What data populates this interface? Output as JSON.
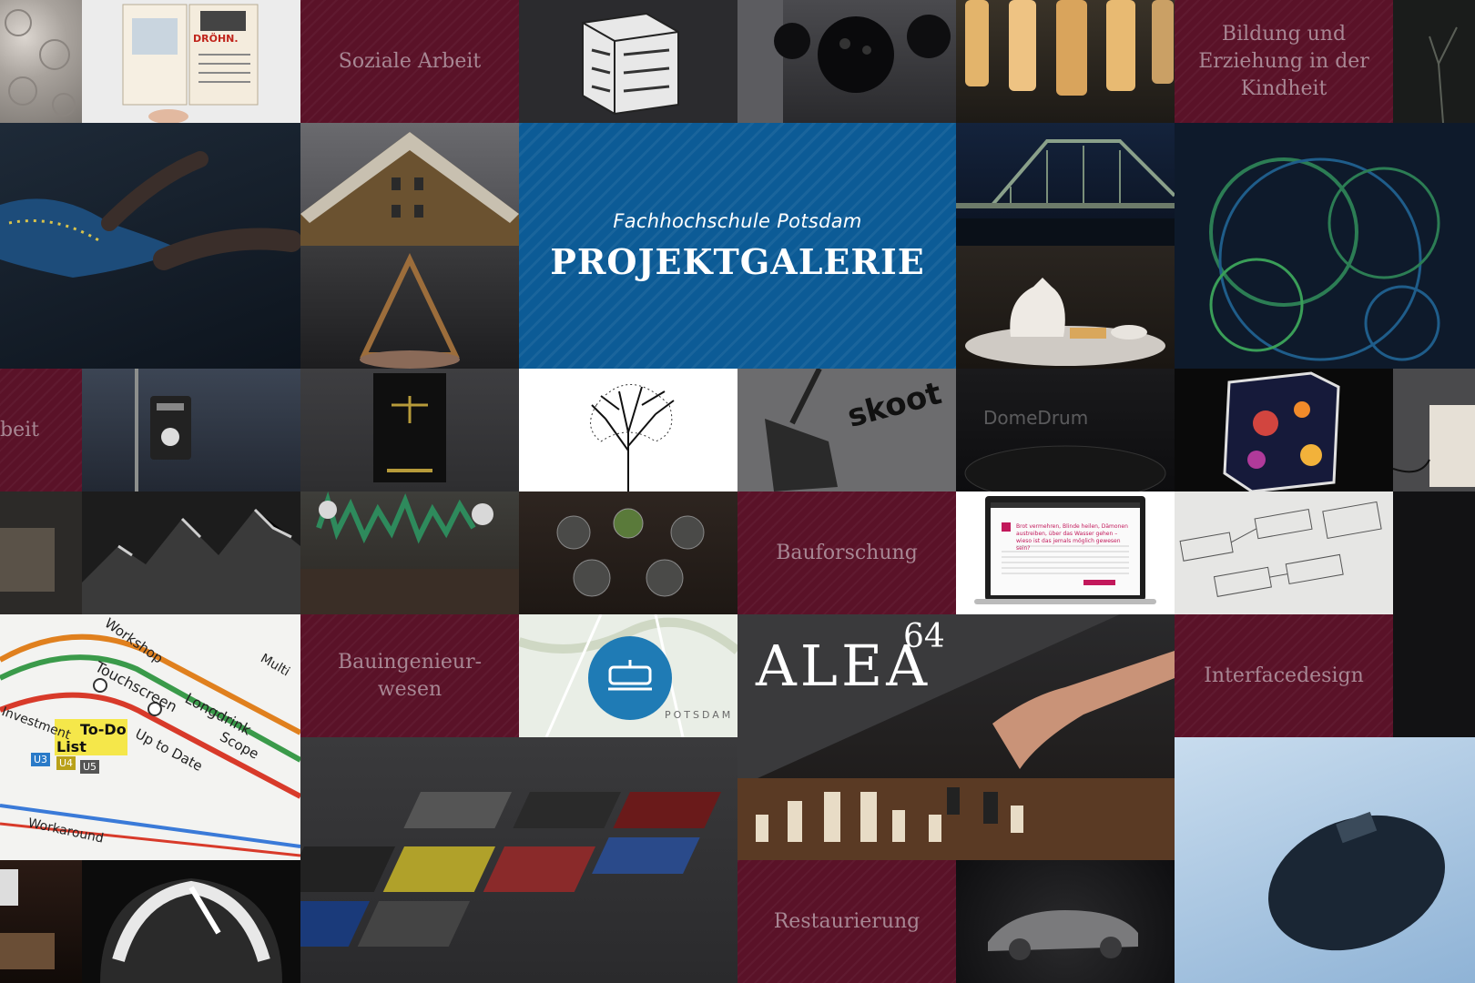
{
  "hero": {
    "subtitle": "Fachhochschule Potsdam",
    "title": "PROJEKTGALERIE"
  },
  "categories": {
    "soziale_arbeit": "Soziale Arbeit",
    "bildung": "Bildung und\nErziehung in der\nKindheit",
    "soziale_arbeit_partial": "beit",
    "bauforschung": "Bauforschung",
    "bauingenieurwesen": "Bauingenieur-\nwesen",
    "interfacedesign": "Interfacedesign",
    "restaurierung": "Restaurierung"
  },
  "photo_text": {
    "book_headline": "DRÖHN.",
    "skoot": "skoot",
    "domedrum": "DomeDrum",
    "alea": "ALEA",
    "alea_sup": "64",
    "potsdam": "POTSDAM",
    "map_labels": [
      "Workshop",
      "Touchscreen",
      "Longdrink",
      "To-Do",
      "List",
      "Up to Date",
      "Scope",
      "Workaround",
      "Investment",
      "Multi"
    ],
    "map_badges": [
      "U3",
      "U4",
      "U5"
    ],
    "laptop_headline": "Brot vermehren, Blinde heilen, Dämonen austreiben, über das Wasser gehen – wieso ist das jemals möglich gewesen sein?",
    "flow_labels": [
      "der Hilfeplanung im",
      "Dokumentations- u. Evaluationsinstrumente",
      "Meldung des Problems beim Jugendamt",
      "Fallklärung",
      "keine Intervention",
      "Meldebogen des ASD",
      "Intervention",
      "Auftrag an Koordination",
      "Vorbereitung des FR mit Netzwerk der Familie",
      "Check-Liste für Koordinatoren"
    ]
  },
  "colors": {
    "category_bg": "#5a1228",
    "category_text": "#a88794",
    "hero_bg": "#0c5b96"
  }
}
